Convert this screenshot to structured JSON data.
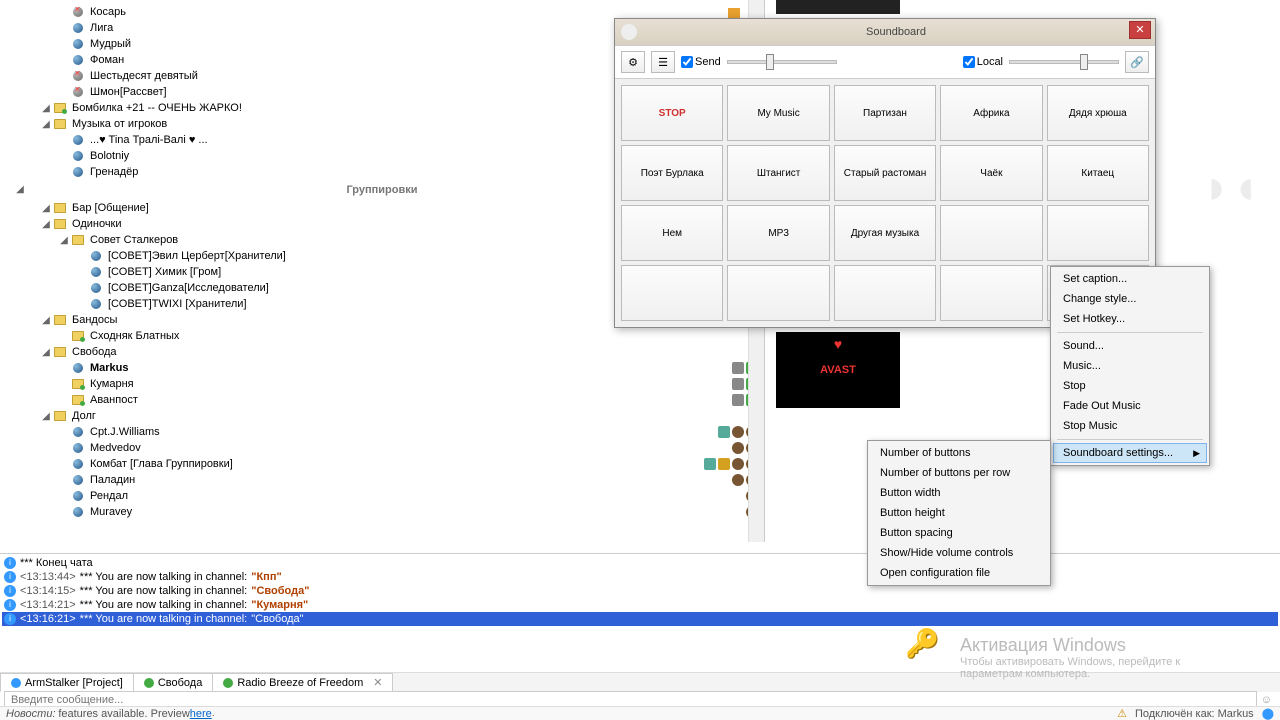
{
  "tree": {
    "top_items": [
      {
        "indent": 3,
        "icon": "muted",
        "label": "Косарь"
      },
      {
        "indent": 3,
        "icon": "blue",
        "label": "Лига"
      },
      {
        "indent": 3,
        "icon": "blue",
        "label": "Мудрый"
      },
      {
        "indent": 3,
        "icon": "blue",
        "label": "Фоман"
      },
      {
        "indent": 3,
        "icon": "muted",
        "label": "Шестьдесят девятый"
      },
      {
        "indent": 3,
        "icon": "muted",
        "label": "Шмон[Рассвет]"
      },
      {
        "indent": 2,
        "icon": "channel-green",
        "exp": true,
        "label": "Бомбилка +21 -- ОЧЕНЬ ЖАРКО!"
      },
      {
        "indent": 2,
        "icon": "channel",
        "exp": true,
        "label": "Музыка от игроков"
      },
      {
        "indent": 3,
        "icon": "blue",
        "label": "...♥ Tina Тралі-Валі ♥ ..."
      },
      {
        "indent": 3,
        "icon": "blue",
        "label": "Bolotniy"
      },
      {
        "indent": 3,
        "icon": "blue",
        "label": "Гренадёр"
      }
    ],
    "section": "Группировки",
    "bottom_items": [
      {
        "indent": 2,
        "icon": "channel",
        "exp": true,
        "label": "Бар [Общение]"
      },
      {
        "indent": 2,
        "icon": "channel",
        "exp": true,
        "label": "Одиночки"
      },
      {
        "indent": 3,
        "icon": "channel",
        "exp": true,
        "label": "Совет Сталкеров"
      },
      {
        "indent": 4,
        "icon": "blue",
        "label": "[СОВЕТ]Эвил Церберт[Хранители]"
      },
      {
        "indent": 4,
        "icon": "blue",
        "label": "[СОВЕТ] Химик [Гром]"
      },
      {
        "indent": 4,
        "icon": "blue",
        "label": "[СОВЕТ]Ganza[Исследователи]"
      },
      {
        "indent": 4,
        "icon": "blue",
        "label": "[СОВЕТ]TWIXI [Хранители]"
      },
      {
        "indent": 2,
        "icon": "channel",
        "exp": true,
        "label": "Бандосы"
      },
      {
        "indent": 3,
        "icon": "channel-green",
        "label": "Сходняк Блатных"
      },
      {
        "indent": 2,
        "icon": "channel",
        "exp": true,
        "label": "Свобода"
      },
      {
        "indent": 3,
        "icon": "blue",
        "label": "Markus",
        "bold": true,
        "badges": [
          "lock",
          "green-sq"
        ]
      },
      {
        "indent": 3,
        "icon": "channel-green",
        "label": "Кумарня",
        "badges": [
          "lock",
          "green-sq"
        ]
      },
      {
        "indent": 3,
        "icon": "channel-green",
        "label": "Аванпост",
        "badges": [
          "lock",
          "green-sq"
        ]
      },
      {
        "indent": 2,
        "icon": "channel",
        "exp": true,
        "label": "Долг"
      },
      {
        "indent": 3,
        "icon": "blue",
        "label": "Cpt.J.Williams",
        "badges": [
          "shield",
          "brown",
          "brown"
        ]
      },
      {
        "indent": 3,
        "icon": "blue",
        "label": "Medvedov",
        "badges": [
          "brown",
          "brown"
        ]
      },
      {
        "indent": 3,
        "icon": "blue",
        "label": "Комбат [Глава Группировки]",
        "badges": [
          "shield",
          "crown",
          "brown",
          "brown"
        ]
      },
      {
        "indent": 3,
        "icon": "blue",
        "label": "Паладин",
        "badges": [
          "brown",
          "brown"
        ]
      },
      {
        "indent": 3,
        "icon": "blue",
        "label": "Рендал",
        "badges": [
          "brown"
        ]
      },
      {
        "indent": 3,
        "icon": "blue",
        "label": "Muravey",
        "badges": [
          "brown"
        ]
      }
    ]
  },
  "avast": "AVAST",
  "chat": {
    "lines": [
      {
        "text": "*** Конец чата",
        "info": true
      },
      {
        "ts": "<13:13:44>",
        "body": "*** You are now talking in channel:",
        "quote": "\"Кпп\"",
        "info": true
      },
      {
        "ts": "<13:14:15>",
        "body": "*** You are now talking in channel:",
        "quote": "\"Свобода\"",
        "info": true
      },
      {
        "ts": "<13:14:21>",
        "body": "*** You are now talking in channel:",
        "quote": "\"Кумарня\"",
        "info": true
      },
      {
        "ts": "<13:16:21>",
        "body": "*** You are now talking in channel:",
        "quote": "\"Свобода\"",
        "info": true,
        "highlight": true
      }
    ]
  },
  "tabs": [
    {
      "label": "ArmStalker [Project]",
      "color": "#39f"
    },
    {
      "label": "Свобода",
      "color": "#4a4"
    },
    {
      "label": "Radio Breeze of Freedom",
      "color": "#4a4",
      "closable": true
    }
  ],
  "input_placeholder": "Введите сообщение...",
  "status": {
    "left_label": "Новости:",
    "left_text": "features available. Preview ",
    "left_link": "here",
    "right": "Подключён как: Markus"
  },
  "soundboard": {
    "title": "Soundboard",
    "send": "Send",
    "local": "Local",
    "buttons": [
      "STOP",
      "My Music",
      "Партизан",
      "Африка",
      "Дядя хрюша",
      "Поэт Бурлака",
      "Штангист",
      "Старый растоман",
      "Чаёк",
      "Китаец",
      "Нем",
      "MP3",
      "Другая музыка",
      "",
      "",
      "",
      "",
      "",
      "",
      ""
    ]
  },
  "context_menu": {
    "items_a": [
      "Set caption...",
      "Change style...",
      "Set Hotkey..."
    ],
    "items_b": [
      "Sound...",
      "Music...",
      "Stop",
      "Fade Out Music",
      "Stop Music"
    ],
    "items_c": [
      "Soundboard settings..."
    ]
  },
  "submenu": {
    "items": [
      "Number of buttons",
      "Number of buttons per row",
      "Button width",
      "Button height",
      "Button spacing",
      "Show/Hide volume controls",
      "Open configuration file"
    ]
  },
  "watermark": {
    "title": "Активация Windows",
    "sub": "Чтобы активировать Windows, перейдите к параметрам компьютера."
  }
}
